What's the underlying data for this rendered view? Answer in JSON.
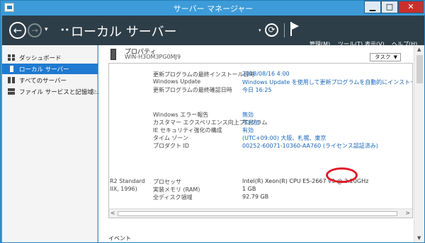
{
  "window": {
    "title": "サーバー マネージャー",
    "min_label": "▁",
    "max_label": "□",
    "close_label": "✕"
  },
  "header": {
    "back_icon": "←",
    "forward_icon": "→",
    "nav_dropdown": "▾",
    "breadcrumb_dots": "••",
    "title": "ローカル サーバー",
    "refresh_dropdown": "▾",
    "refresh_icon": "⟳",
    "menu": [
      "管理(M)",
      "ツール(T)",
      "表示(V)",
      "ヘルプ(H)"
    ]
  },
  "sidebar": {
    "items": [
      {
        "label": "ダッシュボード",
        "icon": "dashboard-icon",
        "active": false
      },
      {
        "label": "ローカル サーバー",
        "icon": "server-icon",
        "active": true
      },
      {
        "label": "すべてのサーバー",
        "icon": "servers-icon",
        "active": false
      },
      {
        "label": "ファイル サービスと記憶域...",
        "icon": "file-services-icon",
        "active": false
      }
    ],
    "expand_arrow": "▷"
  },
  "main": {
    "heading": "プロパティ",
    "server_name": "WIN-H3OM3PG0MJ9",
    "tasks_label": "タスク",
    "tasks_arrow": "▼",
    "properties": [
      {
        "label": "更新プログラムの最終インストール日時",
        "value": "2018/08/16 4:00"
      },
      {
        "label": "Windows Update",
        "value": "Windows Update を使用して更新プログラムを自動的にインストールする"
      },
      {
        "label": "更新プログラムの最終確認日時",
        "value": "今日 16:25"
      },
      {
        "label": "Windows エラー報告",
        "value": "無効"
      },
      {
        "label": "カスタマー エクスペリエンス向上プログラム",
        "value": "不参加"
      },
      {
        "label": "IE セキュリティ強化の構成",
        "value": "有効"
      },
      {
        "label": "タイム ゾーン",
        "value": "(UTC+09:00) 大阪、札幌、東京"
      },
      {
        "label": "プロダクト ID",
        "value": "00252-60071-10360-AA760 (ライセンス認証済み)"
      },
      {
        "label": "プロセッサ",
        "value": "Intel(R) Xeon(R) CPU E5-2667 v3 @ 3.20GHz"
      },
      {
        "label": "実装メモリ (RAM)",
        "value": "1 GB"
      },
      {
        "label": "全ディスク領域",
        "value": "92.79 GB"
      }
    ],
    "os_cut_line1": "R2 Standard",
    "os_cut_line2": "IIX, 1996)",
    "hscroll_left": "<",
    "hscroll_right": ">",
    "vscroll_up": "▲",
    "vscroll_down": "▼",
    "events_label": "イベント"
  },
  "colors": {
    "title_bar": "#3c9bd8",
    "header_bg": "#2d3e48",
    "active_item": "#1f7ad1",
    "link": "#1a66b8",
    "annotation": "#e01a2a"
  }
}
